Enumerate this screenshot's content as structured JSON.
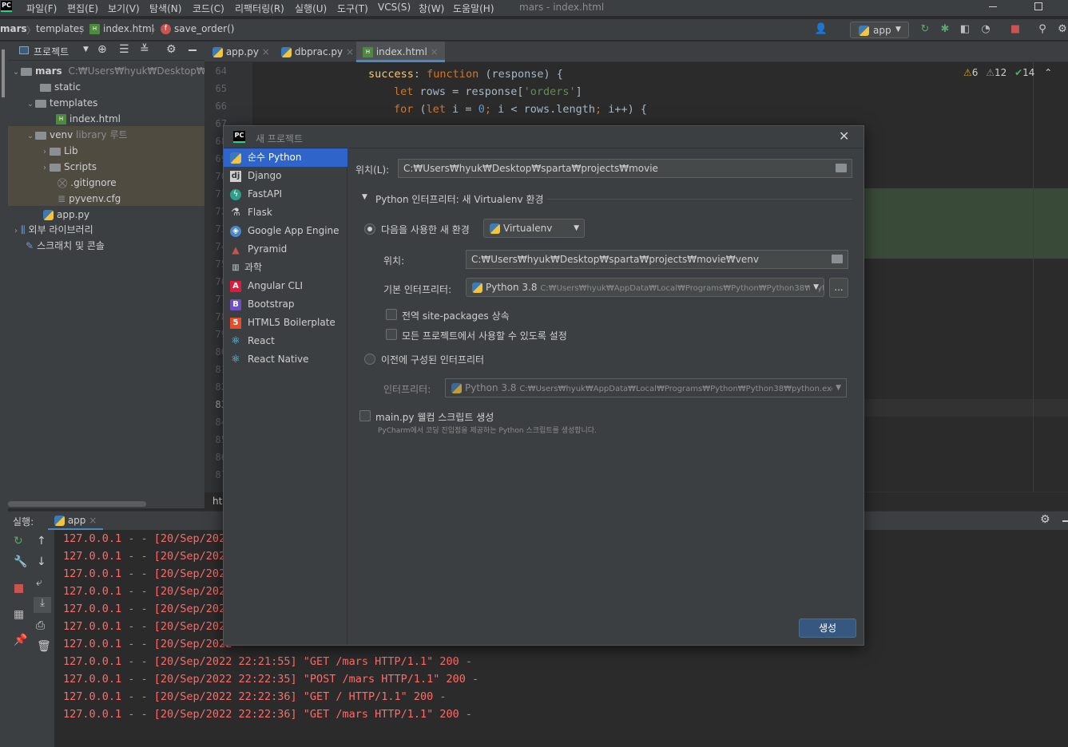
{
  "menubar": {
    "logo": "PC",
    "items": [
      "파일(F)",
      "편집(E)",
      "보기(V)",
      "탐색(N)",
      "코드(C)",
      "리팩터링(R)",
      "실행(U)",
      "도구(T)",
      "VCS(S)",
      "창(W)",
      "도움말(H)"
    ],
    "window_title": "mars - index.html"
  },
  "breadcrumbs": {
    "root": "mars",
    "folder": "templates",
    "file": "index.html",
    "func": "save_order()"
  },
  "toolbar": {
    "run_config": "app"
  },
  "project_panel": {
    "title": "프로젝트",
    "root_name": "mars",
    "root_path": "C:₩Users₩hyuk₩Desktop₩sparta",
    "items": {
      "static": "static",
      "templates": "templates",
      "index": "index.html",
      "venv": "venv",
      "venv_note": "library 루트",
      "lib": "Lib",
      "scripts": "Scripts",
      "gitignore": ".gitignore",
      "pyvenv": "pyvenv.cfg",
      "app": "app.py",
      "ext_libs": "외부 라이브러리",
      "scratches": "스크래치 및 콘솔"
    }
  },
  "editor": {
    "tabs": [
      "app.py",
      "dbprac.py",
      "index.html"
    ],
    "warnings": "6",
    "weak_warnings": "12",
    "typos": "14",
    "line_numbers": [
      "64",
      "65",
      "66",
      "67",
      "68",
      "69",
      "70",
      "71",
      "72",
      "73",
      "74",
      "75",
      "76",
      "77",
      "78",
      "79",
      "80",
      "81",
      "82",
      "83",
      "84",
      "85",
      "86",
      "87"
    ],
    "bottom_crumb": "htm"
  },
  "run": {
    "label": "실행:",
    "config": "app",
    "logs": [
      "127.0.0.1 - - [20/Sep/2022",
      "127.0.0.1 - - [20/Sep/2022",
      "127.0.0.1 - - [20/Sep/2022",
      "127.0.0.1 - - [20/Sep/2022",
      "127.0.0.1 - - [20/Sep/2022",
      "127.0.0.1 - - [20/Sep/2022",
      "127.0.0.1 - - [20/Sep/2022",
      "127.0.0.1 - - [20/Sep/2022 22:21:55] \"GET /mars HTTP/1.1\" 200 -",
      "127.0.0.1 - - [20/Sep/2022 22:22:35] \"POST /mars HTTP/1.1\" 200 -",
      "127.0.0.1 - - [20/Sep/2022 22:22:36] \"GET / HTTP/1.1\" 200 -",
      "127.0.0.1 - - [20/Sep/2022 22:22:36] \"GET /mars HTTP/1.1\" 200 -"
    ]
  },
  "dialog": {
    "title": "새 프로젝트",
    "project_types": [
      "순수 Python",
      "Django",
      "FastAPI",
      "Flask",
      "Google App Engine",
      "Pyramid",
      "과학",
      "Angular CLI",
      "Bootstrap",
      "HTML5 Boilerplate",
      "React",
      "React Native"
    ],
    "location_label": "위치(L):",
    "location_value": "C:₩Users₩hyuk₩Desktop₩sparta₩projects₩movie",
    "interpreter_section": "Python 인터프리터: 새 Virtualenv 환경",
    "new_env_label": "다음을 사용한 새 환경",
    "env_tool": "Virtualenv",
    "venv_location_label": "위치:",
    "venv_location_value": "C:₩Users₩hyuk₩Desktop₩sparta₩projects₩movie₩venv",
    "base_interp_label": "기본 인터프리터:",
    "base_interp_name": "Python 3.8",
    "base_interp_path": "C:₩Users₩hyuk₩AppData₩Local₩Programs₩Python₩Python38₩pyt",
    "browse": "...",
    "inherit_label": "전역 site-packages 상속",
    "share_label": "모든 프로젝트에서 사용할 수 있도록 설정",
    "existing_label": "이전에 구성된 인터프리터",
    "interp_label": "인터프리터:",
    "interp_name": "Python 3.8",
    "interp_path": "C:₩Users₩hyuk₩AppData₩Local₩Programs₩Python₩Python38₩python.exe",
    "main_py_label": "main.py 웰컴 스크립트 생성",
    "main_py_hint": "PyCharm에서 코딩 진입점을 제공하는 Python 스크립트를 생성합니다.",
    "create_button": "생성"
  }
}
